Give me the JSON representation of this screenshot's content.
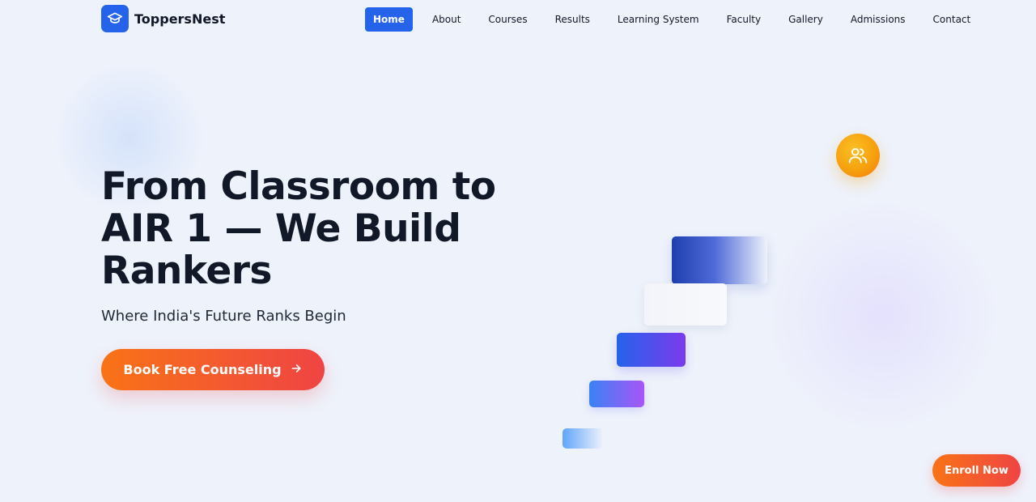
{
  "brand": {
    "name": "ToppersNest",
    "icon": "graduation-cap-icon",
    "color": "#2563eb"
  },
  "nav": {
    "items": [
      {
        "label": "Home",
        "active": true
      },
      {
        "label": "About",
        "active": false
      },
      {
        "label": "Courses",
        "active": false
      },
      {
        "label": "Results",
        "active": false
      },
      {
        "label": "Learning System",
        "active": false
      },
      {
        "label": "Faculty",
        "active": false
      },
      {
        "label": "Gallery",
        "active": false
      },
      {
        "label": "Admissions",
        "active": false
      },
      {
        "label": "Contact",
        "active": false
      }
    ]
  },
  "hero": {
    "title": "From Classroom to AIR 1 — We Build Rankers",
    "subtitle": "Where India's Future Ranks Begin",
    "cta_label": "Book Free Counseling",
    "cta_icon": "arrow-right-icon"
  },
  "floating": {
    "users_icon": "users-icon"
  },
  "enroll": {
    "label": "Enroll Now"
  },
  "colors": {
    "accent": "#2563eb",
    "cta_start": "#f97316",
    "cta_end": "#ef4444",
    "badge": "#f59e0b"
  }
}
